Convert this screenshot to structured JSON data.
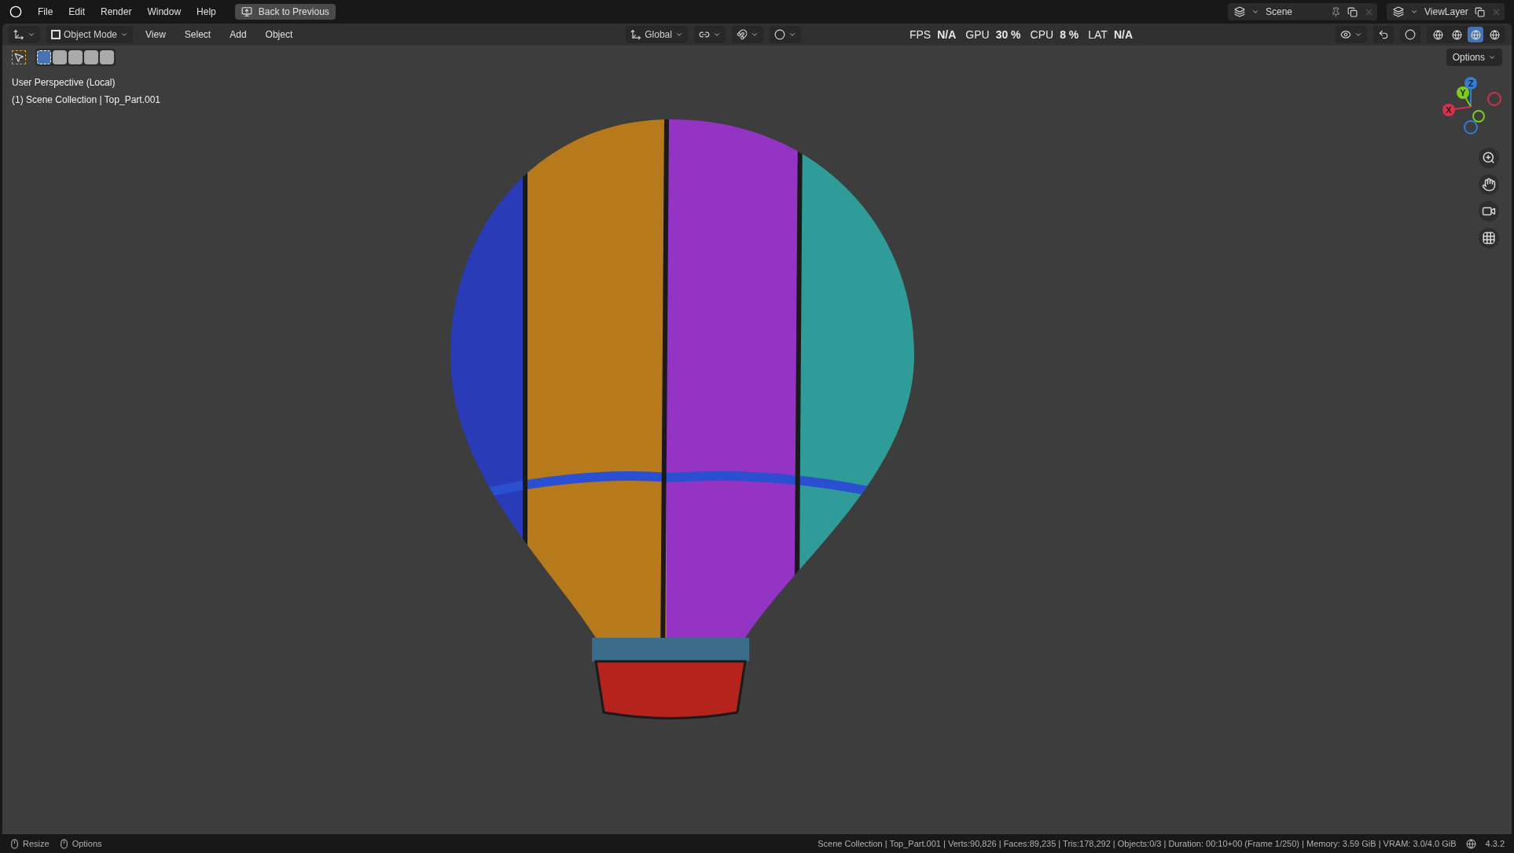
{
  "menu": [
    "File",
    "Edit",
    "Render",
    "Window",
    "Help"
  ],
  "back_button": "Back to Previous",
  "scene": "Scene",
  "view_layer": "ViewLayer",
  "header": {
    "mode": "Object Mode",
    "menus": [
      "View",
      "Select",
      "Add",
      "Object"
    ],
    "orientation": "Global"
  },
  "stats": [
    {
      "label": "FPS",
      "value": "N/A"
    },
    {
      "label": "GPU",
      "value": "30 %"
    },
    {
      "label": "CPU",
      "value": "8 %"
    },
    {
      "label": "LAT",
      "value": "N/A"
    }
  ],
  "select_modes": [
    {
      "selected": true
    },
    {
      "selected": false
    },
    {
      "selected": false
    },
    {
      "selected": false
    },
    {
      "selected": false
    }
  ],
  "shading_modes": [
    {
      "selected": false
    },
    {
      "selected": false
    },
    {
      "selected": true
    },
    {
      "selected": false
    }
  ],
  "options_button": "Options",
  "viewport": {
    "title": "User Perspective (Local)",
    "collection": "(1) Scene Collection | Top_Part.001"
  },
  "axes": [
    {
      "label": "Z",
      "color": "#2f7fd6"
    },
    {
      "label": "Y",
      "color": "#7ecb20"
    },
    {
      "label": "X",
      "color": "#d6304a"
    }
  ],
  "status_bar": {
    "hints": [
      "Resize",
      "Options"
    ],
    "stats": "Scene Collection | Top_Part.001 | Verts:90,826 | Faces:89,235 | Tris:178,292 | Objects:0/3 | Duration: 00:10+00 (Frame 1/250) | Memory: 3.59 GiB | VRAM: 3.0/4.0 GiB",
    "version": "4.3.2"
  }
}
